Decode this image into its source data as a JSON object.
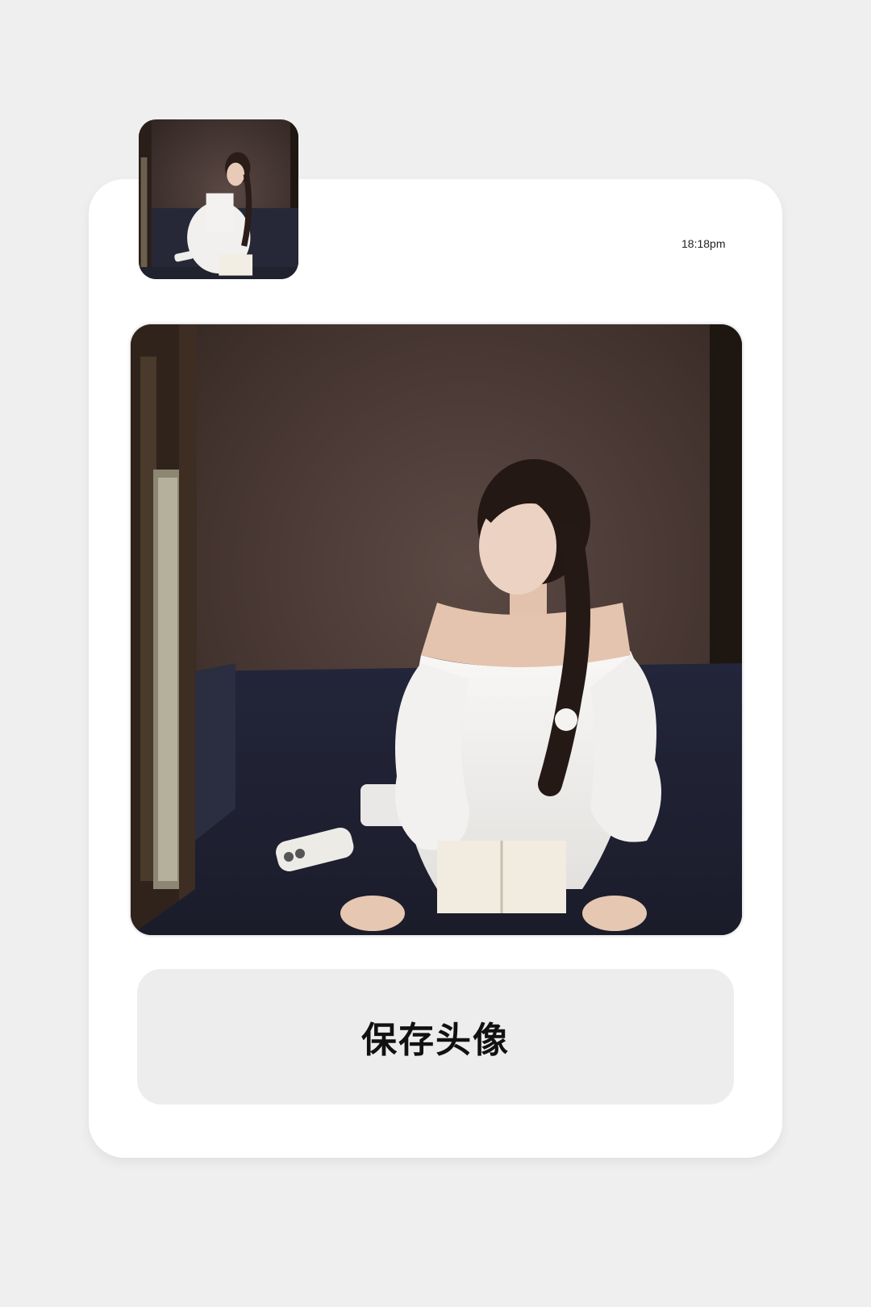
{
  "header": {
    "timestamp": "18:18pm"
  },
  "avatar": {
    "icon": "avatar-preview-image"
  },
  "photo": {
    "icon": "portrait-photo-image"
  },
  "actions": {
    "save_label": "保存头像"
  },
  "colors": {
    "page_background": "#efefef",
    "card_background": "#ffffff",
    "button_background": "#ededed",
    "button_text": "#111111"
  }
}
